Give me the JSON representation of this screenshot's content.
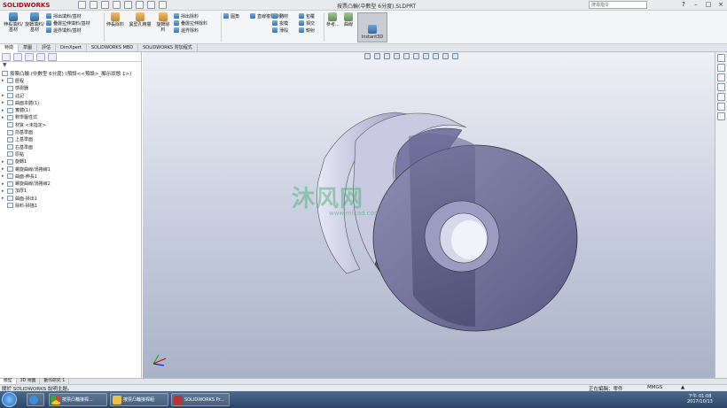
{
  "app": {
    "logo": "SOLIDWORKS",
    "doc_title": "按票凸輪(中數型 6分度).SLDPRT",
    "search_placeholder": "搜尋指令",
    "menu_glyph": "?"
  },
  "ribbon": {
    "group1": {
      "btn1": "伸長填料/基材",
      "btn2": "旋轉填料/基材",
      "r1": "掃出填料/基材",
      "r2": "疊層拉伸填料/基材",
      "r3": "邊界填料/基材"
    },
    "group2": {
      "btn1": "伸長除料",
      "btn2": "異型孔精靈",
      "btn3": "旋轉除料",
      "r1": "掃出除料",
      "r2": "疊層拉伸除料",
      "r3": "邊界除料"
    },
    "group3": {
      "r1": "圓角",
      "r2": "直線複製排列",
      "r3": "肋材",
      "r4": "拔模",
      "r5": "薄殼",
      "r6": "包覆",
      "r7": "相交",
      "r8": "鏡射"
    },
    "group4": {
      "btn1": "參考...",
      "btn2": "曲線",
      "btn3": "Instant3D"
    }
  },
  "tabs": [
    "特徵",
    "草圖",
    "評估",
    "DimXpert",
    "SOLIDWORKS MBD",
    "SOLIDWORKS 附加程式"
  ],
  "tree": {
    "root": "按票凸輪 (中數型 6分度) (預設<<預設>_顯示狀態 1>)",
    "items": [
      "歷程",
      "感測器",
      "註記",
      "曲面本體(1)",
      "實體(1)",
      "數學屬性式",
      "材質 <未指定>",
      "前基準面",
      "上基準面",
      "右基準面",
      "原點",
      "旋轉1",
      "螺旋曲線/渦捲線1",
      "曲面-伸長1",
      "螺旋曲線/渦捲線2",
      "加厚1",
      "曲面-掃出1",
      "除料-掃描1"
    ]
  },
  "viewport": {
    "watermark": "沐风网",
    "watermark_url": "www.mfcad.com"
  },
  "bottom_tabs": [
    "模型",
    "3D 視圖",
    "動作研究 1"
  ],
  "status": {
    "left": "關於 SOLIDWORKS 說明主題。",
    "editing": "正在編輯：零件",
    "units": "MMGS",
    "arrow": "▲"
  },
  "taskbar": {
    "items": [
      "按票凸輪接桿...",
      "按票凸輪接桿組",
      "SOLIDWORKS Pr..."
    ],
    "time": "下午 01:08",
    "date": "2017/10/13"
  }
}
